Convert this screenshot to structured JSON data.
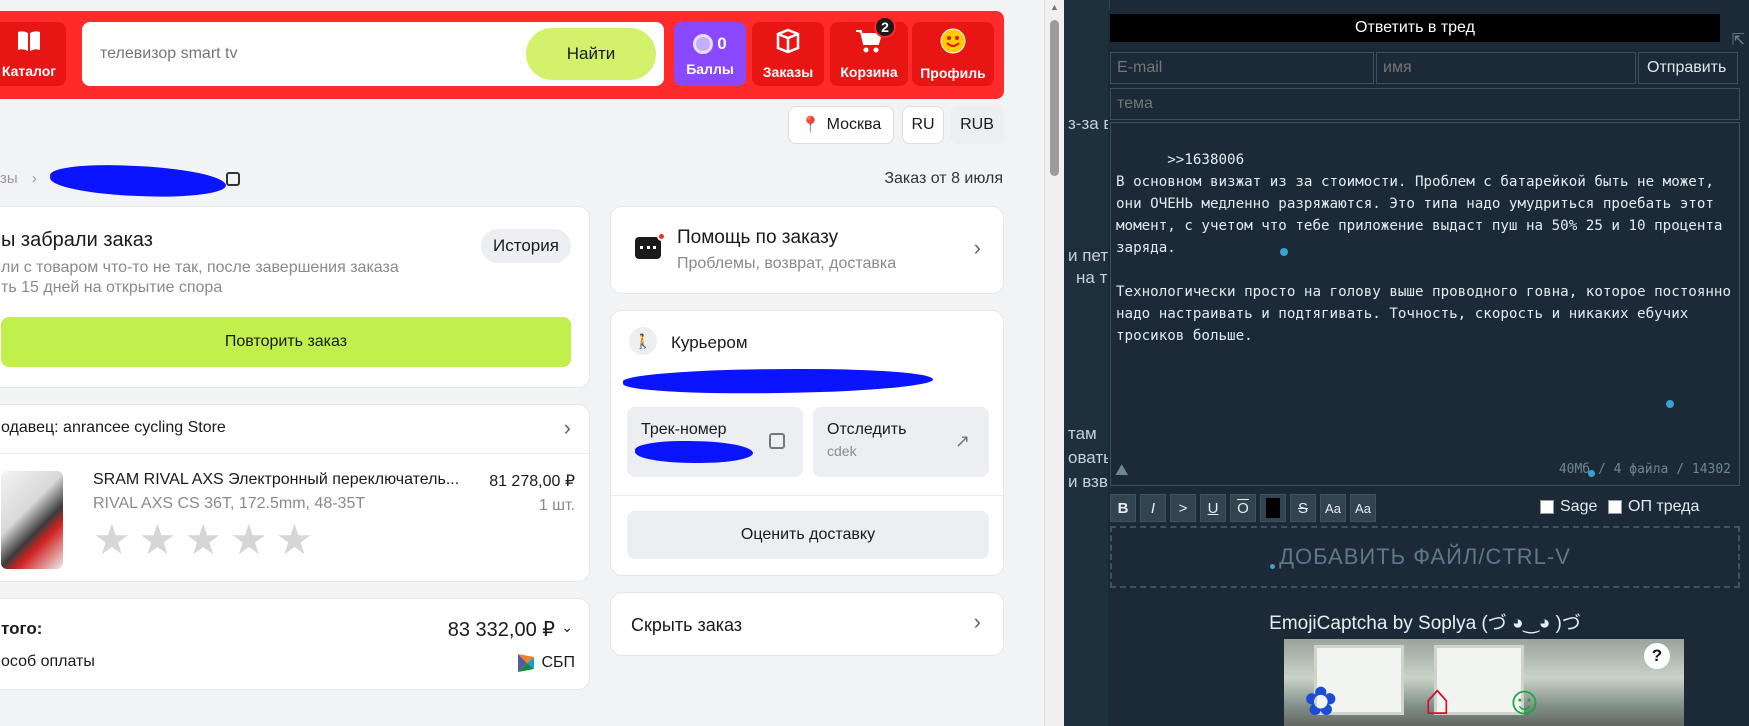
{
  "header": {
    "catalog_label": "Каталог",
    "search_placeholder": "телевизор smart tv",
    "search_button": "Найти",
    "points_count": "0",
    "points_label": "Баллы",
    "orders_label": "Заказы",
    "cart_label": "Корзина",
    "cart_badge": "2",
    "profile_label": "Профиль"
  },
  "locale": {
    "city": "Москва",
    "language": "RU",
    "currency": "RUB"
  },
  "breadcrumb": {
    "prev": "зы",
    "separator": "›"
  },
  "order_date": "Заказ от 8 июля",
  "status_card": {
    "title": "ы забрали заказ",
    "history_button": "История",
    "line1": "ли с товаром что-то не так, после завершения заказа",
    "line2": "ть 15 дней на открытие спора",
    "repeat_button": "Повторить заказ"
  },
  "seller_card": {
    "seller": "одавец: anrancee cycling Store",
    "product_title": "SRAM RIVAL AXS Электронный переключатель...",
    "product_price": "81 278,00 ₽",
    "product_variant": "RIVAL AXS CS 36T, 172.5mm, 48-35T",
    "quantity": "1 шт.",
    "rating_stars": 5
  },
  "total_card": {
    "label": "того:",
    "amount": "83 332,00 ₽",
    "payment_label": "особ оплаты",
    "payment_method": "СБП"
  },
  "help_card": {
    "title": "Помощь по заказу",
    "subtitle": "Проблемы, возврат, доставка"
  },
  "delivery_card": {
    "method": "Курьером",
    "track_label": "Трек-номер",
    "track_action": "Отследить",
    "carrier": "cdek",
    "rate_button": "Оценить доставку"
  },
  "hide_card": {
    "label": "Скрыть заказ"
  },
  "forum": {
    "background_fragments": [
      "з-за в",
      "и пет",
      "на т",
      "там",
      "овать",
      "и взв"
    ],
    "form_title": "Ответить в тред",
    "email_placeholder": "E-mail",
    "name_placeholder": "имя",
    "send_button": "Отправить",
    "subject_placeholder": "тема",
    "message": ">>1638006\nВ основном визжат из за стоимости. Проблем с батарейкой быть не может, они ОЧЕНЬ медленно разряжаются. Это типа надо умудриться проебать этот момент, с учетом что тебе приложение выдаст пуш на 50% 25 и 10 процента заряда.\n\nТехнологически просто на голову выше проводного говна, которое постоянно надо настраивать и подтягивать. Точность, скорость и никаких ебучих тросиков больше.",
    "stats": "40Мб / 4 файла / 14302",
    "toolbar": [
      "B",
      "I",
      ">",
      "U",
      "O",
      "",
      "S",
      "Aa",
      "Aa"
    ],
    "sage_label": "Sage",
    "op_label": "ОП треда",
    "add_file": "ДОБАВИТЬ ФАЙЛ/CTRL-V",
    "captcha_title": "EmojiCaptcha by Soplya (づ ◕‿◕ )づ",
    "captcha_help": "?"
  },
  "colors": {
    "header_red": "#ff2a2a",
    "accent_green": "#c1f04d",
    "points_purple": "#8a48ff",
    "forum_bg": "#1b2a36"
  }
}
